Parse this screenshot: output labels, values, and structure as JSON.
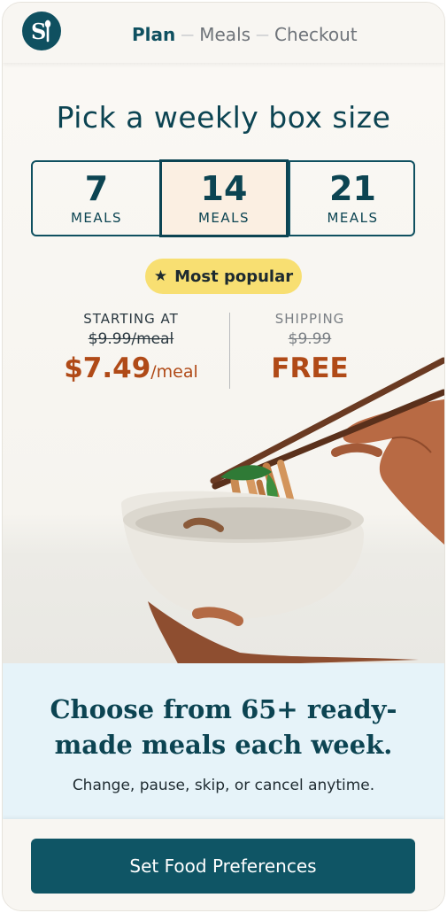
{
  "header": {
    "logo_text": "S",
    "steps": [
      "Plan",
      "Meals",
      "Checkout"
    ],
    "separator": "—"
  },
  "page_title": "Pick a weekly box size",
  "box_options": [
    {
      "number": "7",
      "label": "MEALS",
      "selected": false
    },
    {
      "number": "14",
      "label": "MEALS",
      "selected": true
    },
    {
      "number": "21",
      "label": "MEALS",
      "selected": false
    }
  ],
  "badge": {
    "icon": "star-icon",
    "label": "Most popular"
  },
  "pricing": {
    "starting_caption": "STARTING AT",
    "old_price": "$9.99/meal",
    "new_price": "$7.49",
    "new_unit": "/meal",
    "shipping_caption": "SHIPPING",
    "old_shipping": "$9.99",
    "new_shipping": "FREE"
  },
  "info": {
    "title": "Choose from 65+ ready-made meals each week.",
    "subtitle": "Change, pause, skip, or cancel anytime."
  },
  "cta_label": "Set Food Preferences",
  "colors": {
    "brand": "#0f5060",
    "price_accent": "#b04a17",
    "badge_yellow": "#f8df72",
    "selected_bg": "#fbefe2",
    "info_band": "#e6f3f9"
  }
}
